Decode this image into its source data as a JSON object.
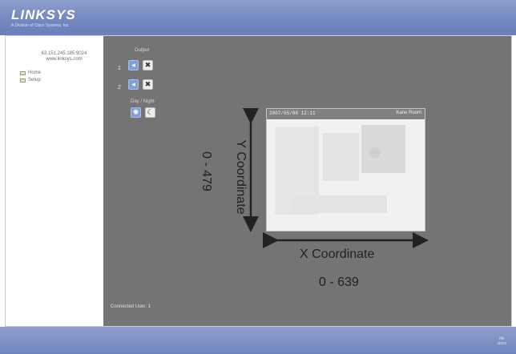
{
  "header": {
    "logo": "LINKSYS",
    "logo_sub": "A Division of Cisco Systems, Inc."
  },
  "sidebar": {
    "ip": "63.151.245.185:9024",
    "site": "www.linksys.com",
    "items": [
      {
        "label": "Home",
        "icon": "home-icon"
      },
      {
        "label": "Setup",
        "icon": "folder-icon"
      }
    ]
  },
  "controls": {
    "output_label": "Output",
    "rows": [
      {
        "num": "1",
        "on_icon": "output-on-icon",
        "off_icon": "output-off-icon"
      },
      {
        "num": "2",
        "on_icon": "output-on-icon",
        "off_icon": "output-off-icon"
      }
    ],
    "day_night_label": "Day / Night",
    "day_icon": "sun-icon",
    "night_icon": "moon-icon"
  },
  "camera": {
    "timestamp": "2007/05/08 12:11",
    "label": "Kane Room"
  },
  "annotations": {
    "y_label": "Y Coordinate",
    "y_range": "0 - 479",
    "x_label": "X Coordinate",
    "x_range": "0 - 639"
  },
  "status": {
    "connected": "Connected User: 1"
  },
  "footer": {
    "brand": "cisco"
  },
  "colors": {
    "header": "#7388bf",
    "main_bg": "#747474",
    "button_blue": "#7fa0d6"
  }
}
